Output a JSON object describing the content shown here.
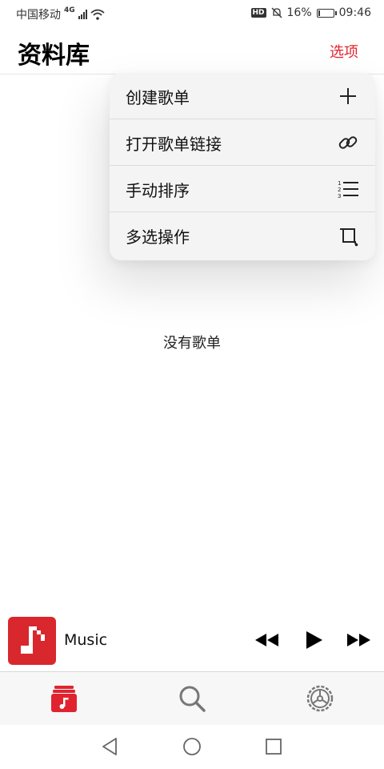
{
  "status_bar": {
    "carrier": "中国移动",
    "network": "4G",
    "battery": "16%",
    "battery_level": 0.16,
    "time": "09:46"
  },
  "header": {
    "title": "资料库",
    "options_label": "选项"
  },
  "menu": {
    "items": [
      {
        "label": "创建歌单",
        "icon": "plus-icon"
      },
      {
        "label": "打开歌单链接",
        "icon": "link-icon"
      },
      {
        "label": "手动排序",
        "icon": "numbered-list-icon"
      },
      {
        "label": "多选操作",
        "icon": "crop-icon"
      }
    ]
  },
  "empty_message": "没有歌单",
  "mini_player": {
    "title": "Music",
    "artwork_icon": "music-note-icon",
    "controls": [
      "rewind-icon",
      "play-icon",
      "fast-forward-icon"
    ]
  },
  "tab_bar": {
    "items": [
      {
        "icon": "library-icon",
        "active": true
      },
      {
        "icon": "search-icon",
        "active": false
      },
      {
        "icon": "settings-icon",
        "active": false
      }
    ]
  },
  "colors": {
    "accent": "#e0242f",
    "artwork": "#d9272e",
    "menu_bg": "#f4f4f4",
    "tabbar_bg": "#f7f7f7"
  }
}
